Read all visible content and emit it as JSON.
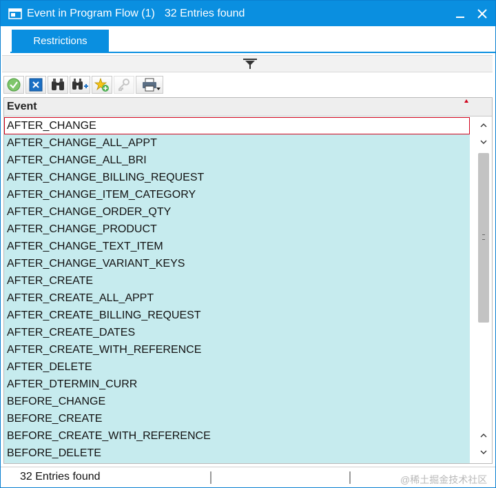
{
  "window": {
    "title": "Event in Program Flow (1)",
    "entries_count": "32 Entries found",
    "controls": [
      "minimize-icon",
      "close-icon"
    ]
  },
  "tabs": [
    {
      "label": "Restrictions"
    }
  ],
  "toolbar": {
    "buttons": [
      {
        "icon": "checkmark-icon",
        "enabled": true
      },
      {
        "icon": "cancel-icon",
        "enabled": true
      },
      {
        "icon": "binoculars-icon",
        "enabled": true
      },
      {
        "icon": "binoculars-plus-icon",
        "enabled": true
      },
      {
        "icon": "star-add-icon",
        "enabled": true
      },
      {
        "icon": "key-icon",
        "enabled": false
      },
      {
        "icon": "printer-icon",
        "enabled": true
      }
    ]
  },
  "grid": {
    "column_header": "Event",
    "rows": [
      "AFTER_CHANGE",
      "AFTER_CHANGE_ALL_APPT",
      "AFTER_CHANGE_ALL_BRI",
      "AFTER_CHANGE_BILLING_REQUEST",
      "AFTER_CHANGE_ITEM_CATEGORY",
      "AFTER_CHANGE_ORDER_QTY",
      "AFTER_CHANGE_PRODUCT",
      "AFTER_CHANGE_TEXT_ITEM",
      "AFTER_CHANGE_VARIANT_KEYS",
      "AFTER_CREATE",
      "AFTER_CREATE_ALL_APPT",
      "AFTER_CREATE_BILLING_REQUEST",
      "AFTER_CREATE_DATES",
      "AFTER_CREATE_WITH_REFERENCE",
      "AFTER_DELETE",
      "AFTER_DTERMIN_CURR",
      "BEFORE_CHANGE",
      "BEFORE_CREATE",
      "BEFORE_CREATE_WITH_REFERENCE",
      "BEFORE_DELETE"
    ],
    "selected_index": 0
  },
  "status": {
    "text": "32 Entries found"
  },
  "watermark": "@稀土掘金技术社区",
  "colors": {
    "title_bar": "#0a8fe0",
    "row_background": "#c6ebee",
    "selection_border": "#d0021b"
  }
}
